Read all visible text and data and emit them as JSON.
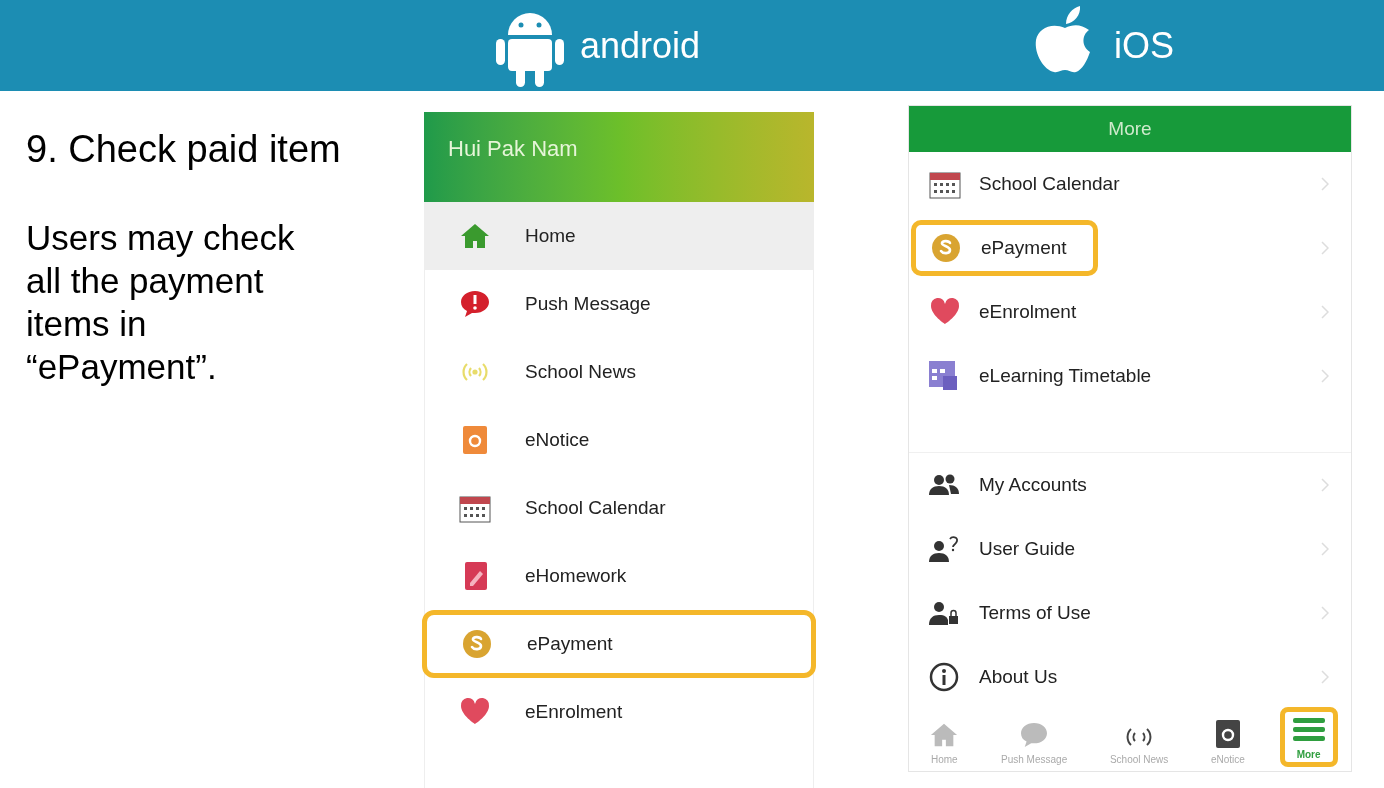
{
  "banner": {
    "platforms": [
      {
        "name": "android"
      },
      {
        "name": "iOS"
      }
    ]
  },
  "instructions": {
    "step": "9. Check paid item",
    "body": "Users may check all the payment items in “ePayment”."
  },
  "android": {
    "user_name": "Hui Pak Nam",
    "menu": [
      {
        "label": "Home",
        "selected": true,
        "highlighted": false
      },
      {
        "label": "Push Message",
        "selected": false,
        "highlighted": false
      },
      {
        "label": "School News",
        "selected": false,
        "highlighted": false
      },
      {
        "label": "eNotice",
        "selected": false,
        "highlighted": false
      },
      {
        "label": "School Calendar",
        "selected": false,
        "highlighted": false
      },
      {
        "label": "eHomework",
        "selected": false,
        "highlighted": false
      },
      {
        "label": "ePayment",
        "selected": false,
        "highlighted": true
      },
      {
        "label": "eEnrolment",
        "selected": false,
        "highlighted": false
      }
    ]
  },
  "ios": {
    "title": "More",
    "sections": [
      [
        {
          "label": "School Calendar",
          "highlighted": false
        },
        {
          "label": "ePayment",
          "highlighted": true
        },
        {
          "label": "eEnrolment",
          "highlighted": false
        },
        {
          "label": "eLearning Timetable",
          "highlighted": false
        }
      ],
      [
        {
          "label": "My Accounts",
          "highlighted": false
        },
        {
          "label": "User Guide",
          "highlighted": false
        },
        {
          "label": "Terms of Use",
          "highlighted": false
        },
        {
          "label": "About Us",
          "highlighted": false
        }
      ]
    ],
    "tabs": [
      {
        "label": "Home",
        "selected": false,
        "highlighted": false
      },
      {
        "label": "Push Message",
        "selected": false,
        "highlighted": false
      },
      {
        "label": "School News",
        "selected": false,
        "highlighted": false
      },
      {
        "label": "eNotice",
        "selected": false,
        "highlighted": false
      },
      {
        "label": "More",
        "selected": true,
        "highlighted": true
      }
    ]
  }
}
